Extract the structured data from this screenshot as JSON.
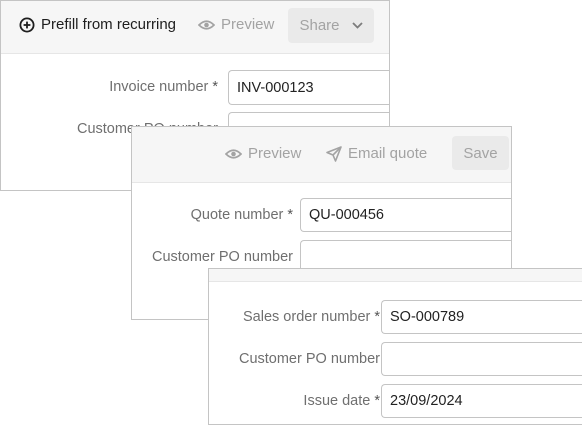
{
  "invoice_window": {
    "toolbar": {
      "prefill_label": "Prefill from recurring",
      "preview_label": "Preview",
      "share_label": "Share"
    },
    "fields": [
      {
        "label": "Invoice number",
        "required": "*",
        "value": "INV-000123"
      },
      {
        "label": "Customer PO number",
        "required": "",
        "value": ""
      }
    ]
  },
  "quote_window": {
    "toolbar": {
      "preview_label": "Preview",
      "email_label": "Email quote",
      "save_label": "Save"
    },
    "fields": [
      {
        "label": "Quote number",
        "required": "*",
        "value": "QU-000456"
      },
      {
        "label": "Customer PO number",
        "required": "",
        "value": ""
      }
    ]
  },
  "sales_order_window": {
    "fields": [
      {
        "label": "Sales order number",
        "required": "*",
        "value": "SO-000789"
      },
      {
        "label": "Customer PO number",
        "required": "",
        "value": ""
      },
      {
        "label": "Issue date",
        "required": "*",
        "value": "23/09/2024"
      }
    ]
  },
  "icons": {
    "prefill": "plus-circle-icon",
    "preview": "eye-icon",
    "share_dropdown": "chevron-down-icon",
    "email": "send-icon"
  },
  "colors": {
    "toolbar_bg": "#f6f6f6",
    "muted_text": "#a3a3a3",
    "label_text": "#6f6f6f",
    "border": "#c4c4c4"
  }
}
